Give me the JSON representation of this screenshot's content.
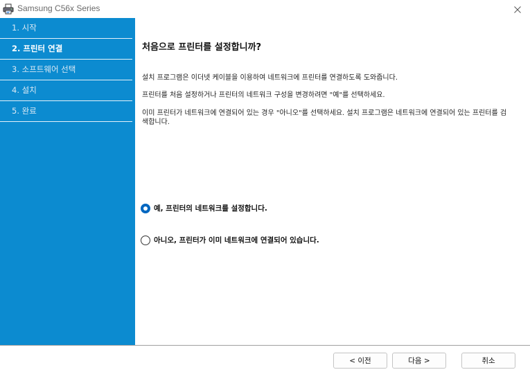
{
  "window": {
    "title": "Samsung C56x Series",
    "icon": "printer-icon",
    "close_icon": "close-icon"
  },
  "sidebar": {
    "steps": [
      {
        "label": "1. 시작",
        "state": "inactive"
      },
      {
        "label": "2. 프린터 연결",
        "state": "active"
      },
      {
        "label": "3. 소프트웨어 선택",
        "state": "inactive"
      },
      {
        "label": "4. 설치",
        "state": "inactive"
      },
      {
        "label": "5. 완료",
        "state": "inactive"
      }
    ],
    "color": "#0c8bd0"
  },
  "main": {
    "heading": "처음으로 프린터를 설정합니까?",
    "paragraphs": [
      "설치 프로그램은 이더넷 케이블을 이용하여 네트워크에 프린터를 연결하도록 도와줍니다.",
      "프린터를 처음 설정하거나 프린터의 네트워크 구성을 변경하려면 \"예\"를 선택하세요.",
      "이미 프린터가 네트워크에 연결되어 있는 경우 \"아니오\"를 선택하세요. 설치 프로그램은 네트워크에 연결되어 있는 프린터를 검색합니다."
    ],
    "options": [
      {
        "label": "예, 프린터의 네트워크를 설정합니다.",
        "checked": true
      },
      {
        "label": "아니오, 프린터가 이미 네트워크에 연결되어 있습니다.",
        "checked": false
      }
    ]
  },
  "footer": {
    "back_label": "< 이전",
    "next_label": "다음 >",
    "cancel_label": "취소"
  }
}
